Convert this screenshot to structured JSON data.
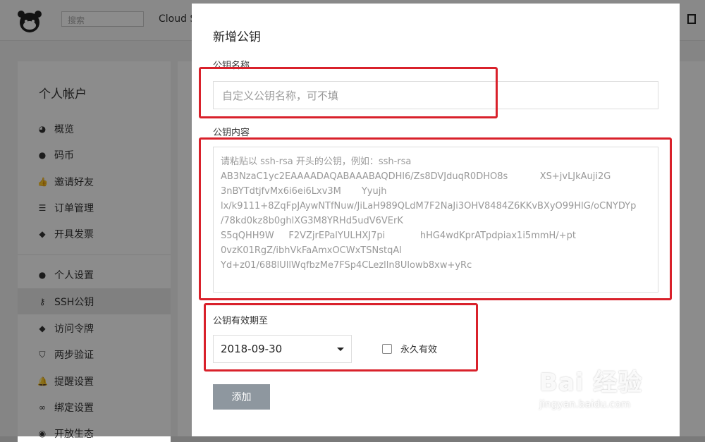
{
  "header": {
    "search_placeholder": "搜索",
    "brand": "Cloud S"
  },
  "sidebar": {
    "title": "个人帐户",
    "items": [
      {
        "label": "概览",
        "icon": "dashboard-icon"
      },
      {
        "label": "码币",
        "icon": "coins-icon"
      },
      {
        "label": "邀请好友",
        "icon": "thumbs-up-icon"
      },
      {
        "label": "订单管理",
        "icon": "list-icon"
      },
      {
        "label": "开具发票",
        "icon": "ticket-icon"
      },
      {
        "label": "个人设置",
        "icon": "user-icon"
      },
      {
        "label": "SSH公钥",
        "icon": "key-icon",
        "active": true
      },
      {
        "label": "访问令牌",
        "icon": "token-icon"
      },
      {
        "label": "两步验证",
        "icon": "shield-icon"
      },
      {
        "label": "提醒设置",
        "icon": "bell-icon"
      },
      {
        "label": "绑定设置",
        "icon": "link-icon"
      },
      {
        "label": "开放生态",
        "icon": "globe-icon"
      }
    ]
  },
  "modal": {
    "title": "新增公钥",
    "name_label": "公钥名称",
    "name_placeholder": "自定义公钥名称，可不填",
    "content_label": "公钥内容",
    "content_placeholder": "请粘贴以 ssh-rsa 开头的公钥，例如：ssh-rsa\nAB3NzaC1yc2EAAAADAQABAAABAQDHl6/Zs8DVJduqR0DHO8s           XS+jvLJkAuji2G\n3nBYTdtjfvMx6i6ei6Lxv3M       Yyujh\nlx/k9111+8ZqFpJAywNTfNuw/JiLaH989QLdM7F2NaJi3OHV8484Z6KKvBXyO99HlG/oCNYDYp\n/78kd0kz8b0ghlXG3M8YRHd5udV6VErK\nS5qQHH9W     F2VZjrEPalYULHXJ7pi            hHG4wdKprATpdpiax1i5mmH/+pt\n0vzK01RgZ/ibhVkFaAmxOCWxTSNstqAl\nYd+z01/688lUllWqfbzMe7FSp4CLezlln8Ulowb8xw+yRc",
    "expiry_label": "公钥有效期至",
    "expiry_value": "2018-09-30",
    "permanent_label": "永久有效",
    "permanent_checked": false,
    "submit_label": "添加"
  },
  "watermark": {
    "main": "Bai 经验",
    "sub": "jingyan.baidu.com"
  },
  "colors": {
    "annotation_red": "#d9212b",
    "button_gray": "#8e979f"
  }
}
